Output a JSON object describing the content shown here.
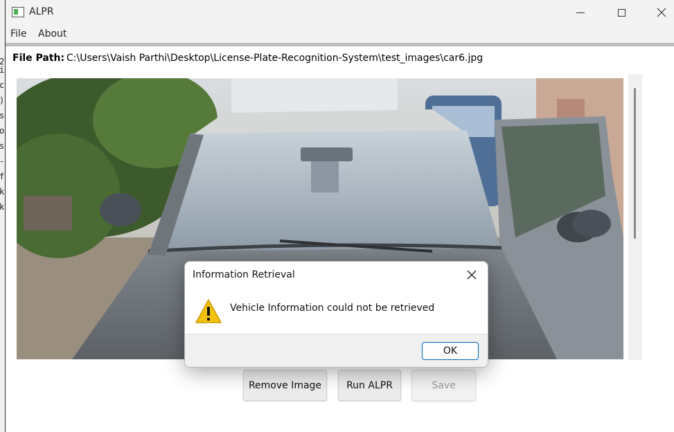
{
  "window": {
    "title": "ALPR",
    "icon": "app-window-icon"
  },
  "titlebar_controls": {
    "minimize": "minimize-icon",
    "maximize": "maximize-icon",
    "close": "close-icon"
  },
  "menu": {
    "items": [
      {
        "label": "File"
      },
      {
        "label": "About"
      }
    ]
  },
  "file_path": {
    "label": "File Path:",
    "value": "C:\\Users\\Vaish Parthi\\Desktop\\License-Plate-Recognition-System\\test_images\\car6.jpg"
  },
  "image_preview": {
    "icon": "car-photo"
  },
  "buttons": {
    "remove_image": "Remove Image",
    "run_alpr": "Run ALPR",
    "save": "Save"
  },
  "dialog": {
    "title": "Information Retrieval",
    "message": "Vehicle Information could not be retrieved",
    "ok_label": "OK",
    "close_icon": "close-icon",
    "warning_icon": "warning-icon",
    "warning_color": "#f2c10e"
  },
  "background_terminal": {
    "chars": [
      "2",
      "i",
      "",
      "c",
      "",
      ")",
      "s",
      "o",
      "s",
      "-",
      "f",
      "k",
      "k"
    ]
  }
}
